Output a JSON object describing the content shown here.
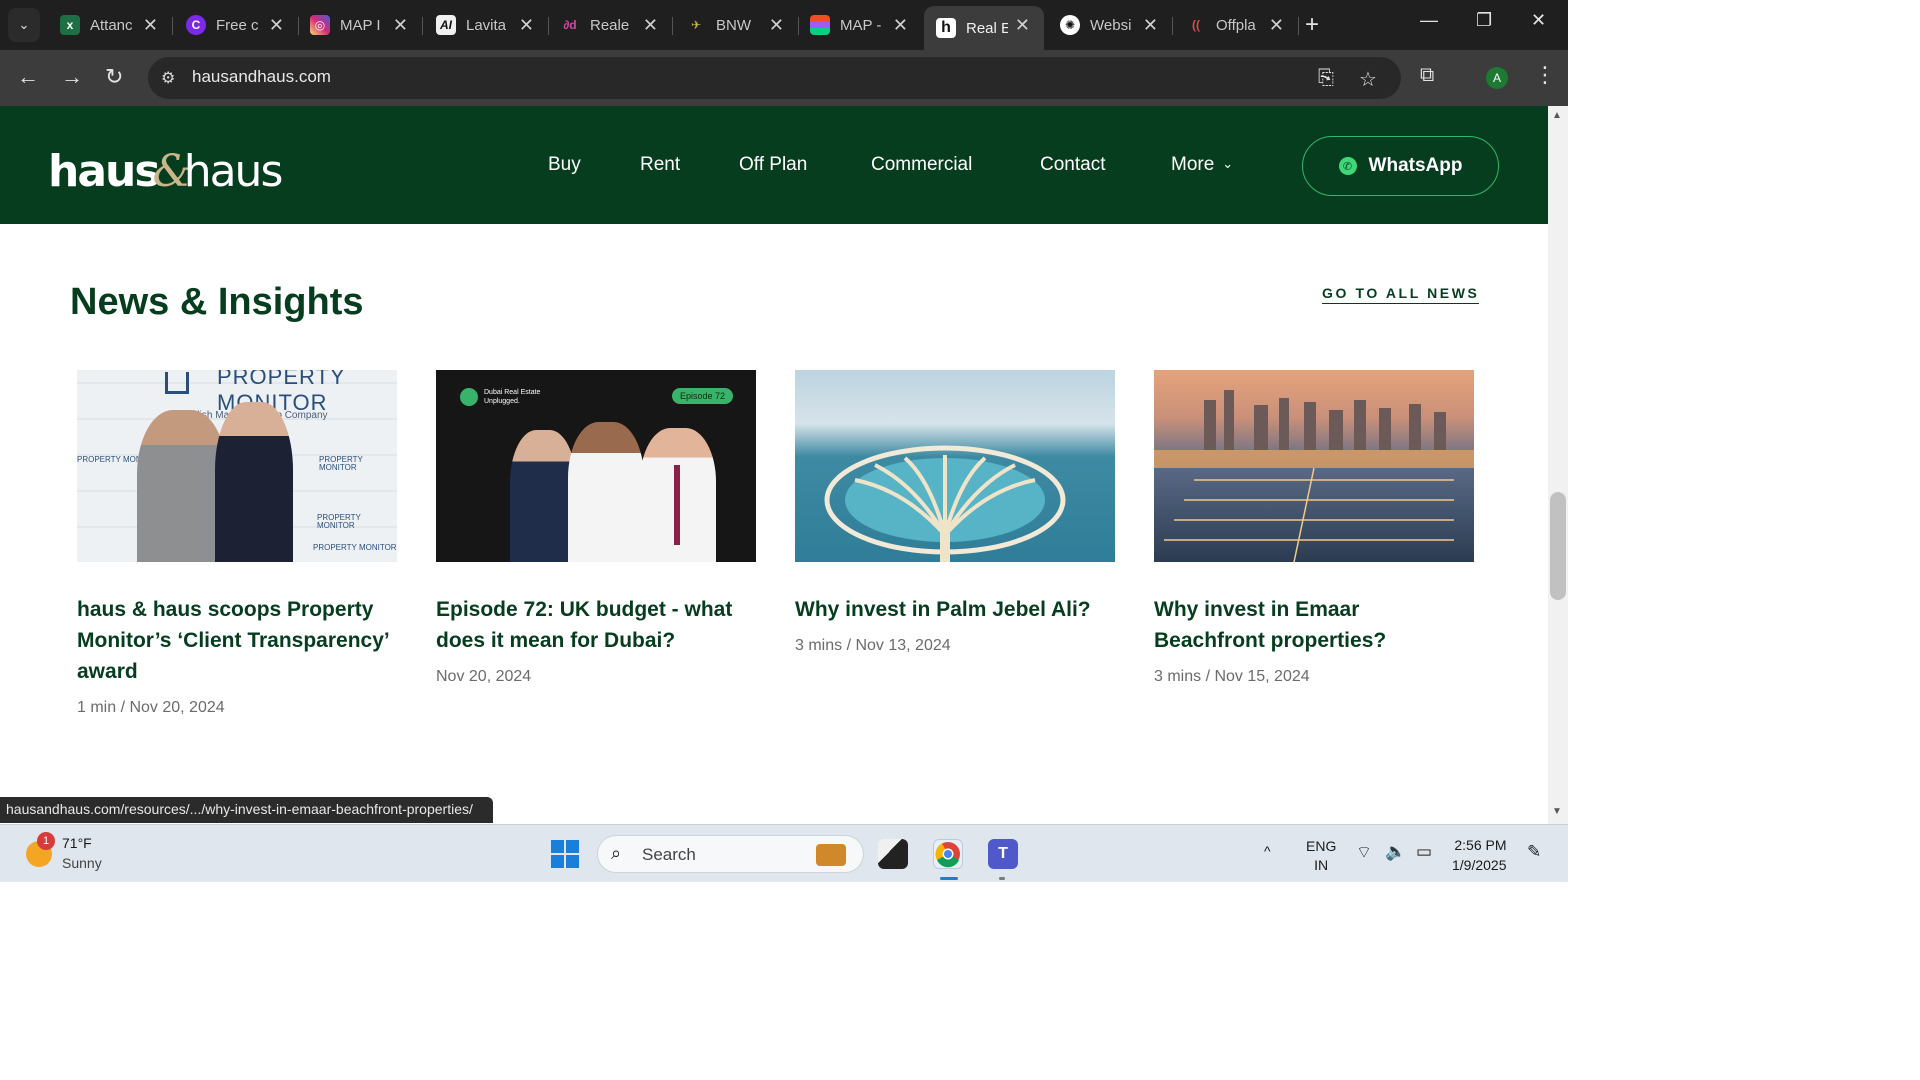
{
  "browser": {
    "tabs": [
      {
        "title": "Attanc",
        "icon": "excel-icon",
        "color": "#1d7044"
      },
      {
        "title": "Free c",
        "icon": "canva-icon",
        "color": "#7d2ae8"
      },
      {
        "title": "MAP I",
        "icon": "instagram-icon",
        "color": "#d62976"
      },
      {
        "title": "Lavita",
        "icon": "ai-icon",
        "color": "#222222"
      },
      {
        "title": "Reale",
        "icon": "realestate-icon",
        "color": "#b03a8c"
      },
      {
        "title": "BNW",
        "icon": "bnw-icon",
        "color": "#8a7a2a"
      },
      {
        "title": "MAP -",
        "icon": "figma-icon",
        "color": "#f24e1e"
      },
      {
        "title": "Real E",
        "icon": "hausandhaus-favicon-icon",
        "color": "#1f1f1f"
      },
      {
        "title": "Websi",
        "icon": "chatgpt-icon",
        "color": "#2b2b2b"
      },
      {
        "title": "Offpla",
        "icon": "offplan-icon",
        "color": "#c0392b"
      }
    ],
    "active_tab_index": 7,
    "url": "hausandhaus.com",
    "profile_initial": "A",
    "status_url": "hausandhaus.com/resources/.../why-invest-in-emaar-beachfront-properties/"
  },
  "site": {
    "logo_left": "haus",
    "logo_amp": "&",
    "logo_right": "haus",
    "nav": [
      "Buy",
      "Rent",
      "Off Plan",
      "Commercial",
      "Contact",
      "More"
    ],
    "whatsapp_label": "WhatsApp",
    "colors": {
      "brand_green": "#063d1e",
      "accent_green": "#2eb86a"
    }
  },
  "news": {
    "title": "News & Insights",
    "all_link": "GO TO ALL NEWS",
    "cards": [
      {
        "title": "haus & haus scoops Property Monitor’s ‘Client Transparency’ award",
        "meta": "1 min  /  Nov 20, 2024",
        "image": {
          "logo": "PROPERTY MONITOR",
          "subtitle": "endish Maxwell Group Company",
          "small": "PROPERTY MONITOR"
        }
      },
      {
        "title": "Episode 72: UK budget - what does it mean for Dubai?",
        "meta": "Nov 20, 2024",
        "image": {
          "badge": "Episode 72",
          "podcast_line1": "Dubai Real Estate",
          "podcast_line2": "Unplugged."
        }
      },
      {
        "title": "Why invest in Palm Jebel Ali?",
        "meta": "3 mins  /  Nov 13, 2024"
      },
      {
        "title": "Why invest in Emaar Beachfront properties?",
        "meta": "3 mins  /  Nov 15, 2024"
      }
    ]
  },
  "taskbar": {
    "weather_temp": "71°F",
    "weather_cond": "Sunny",
    "weather_badge": "1",
    "search_label": "Search",
    "lang_line1": "ENG",
    "lang_line2": "IN",
    "time": "2:56 PM",
    "date": "1/9/2025"
  }
}
